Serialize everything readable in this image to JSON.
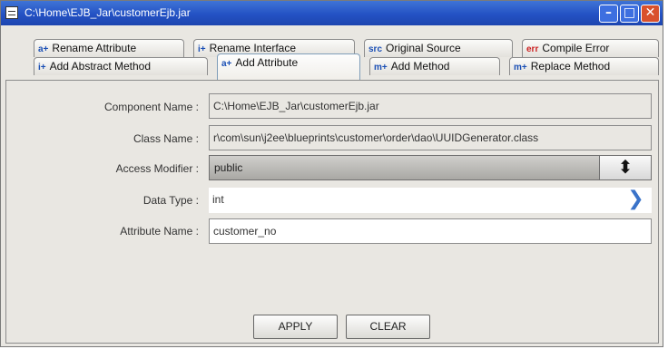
{
  "window": {
    "title": "C:\\Home\\EJB_Jar\\customerEjb.jar",
    "buttons": {
      "minimize": "–",
      "maximize": "□",
      "close": "✕"
    },
    "icon": "window-icon"
  },
  "tabs": {
    "row1": [
      {
        "label": "Rename Attribute",
        "icon": "a+"
      },
      {
        "label": "Rename Interface",
        "icon": "i+"
      },
      {
        "label": "Original Source",
        "icon": "src"
      },
      {
        "label": "Compile Error",
        "icon": "err"
      }
    ],
    "row2": [
      {
        "label": "Add Abstract Method",
        "icon": "i+"
      },
      {
        "label": "Add Attribute",
        "icon": "a+"
      },
      {
        "label": "Add Method",
        "icon": "m+"
      },
      {
        "label": "Replace Method",
        "icon": "m+"
      }
    ],
    "active": "Add Attribute"
  },
  "form": {
    "component_name": {
      "label": "Component Name :",
      "value": "C:\\Home\\EJB_Jar\\customerEjb.jar"
    },
    "class_name": {
      "label": "Class Name :",
      "value": "r\\com\\sun\\j2ee\\blueprints\\customer\\order\\dao\\UUIDGenerator.class"
    },
    "access_modifier": {
      "label": "Access Modifier :",
      "value": "public"
    },
    "data_type": {
      "label": "Data Type :",
      "value": "int"
    },
    "attribute_name": {
      "label": "Attribute Name :",
      "value": "customer_no"
    }
  },
  "actions": {
    "apply": "APPLY",
    "clear": "CLEAR"
  }
}
